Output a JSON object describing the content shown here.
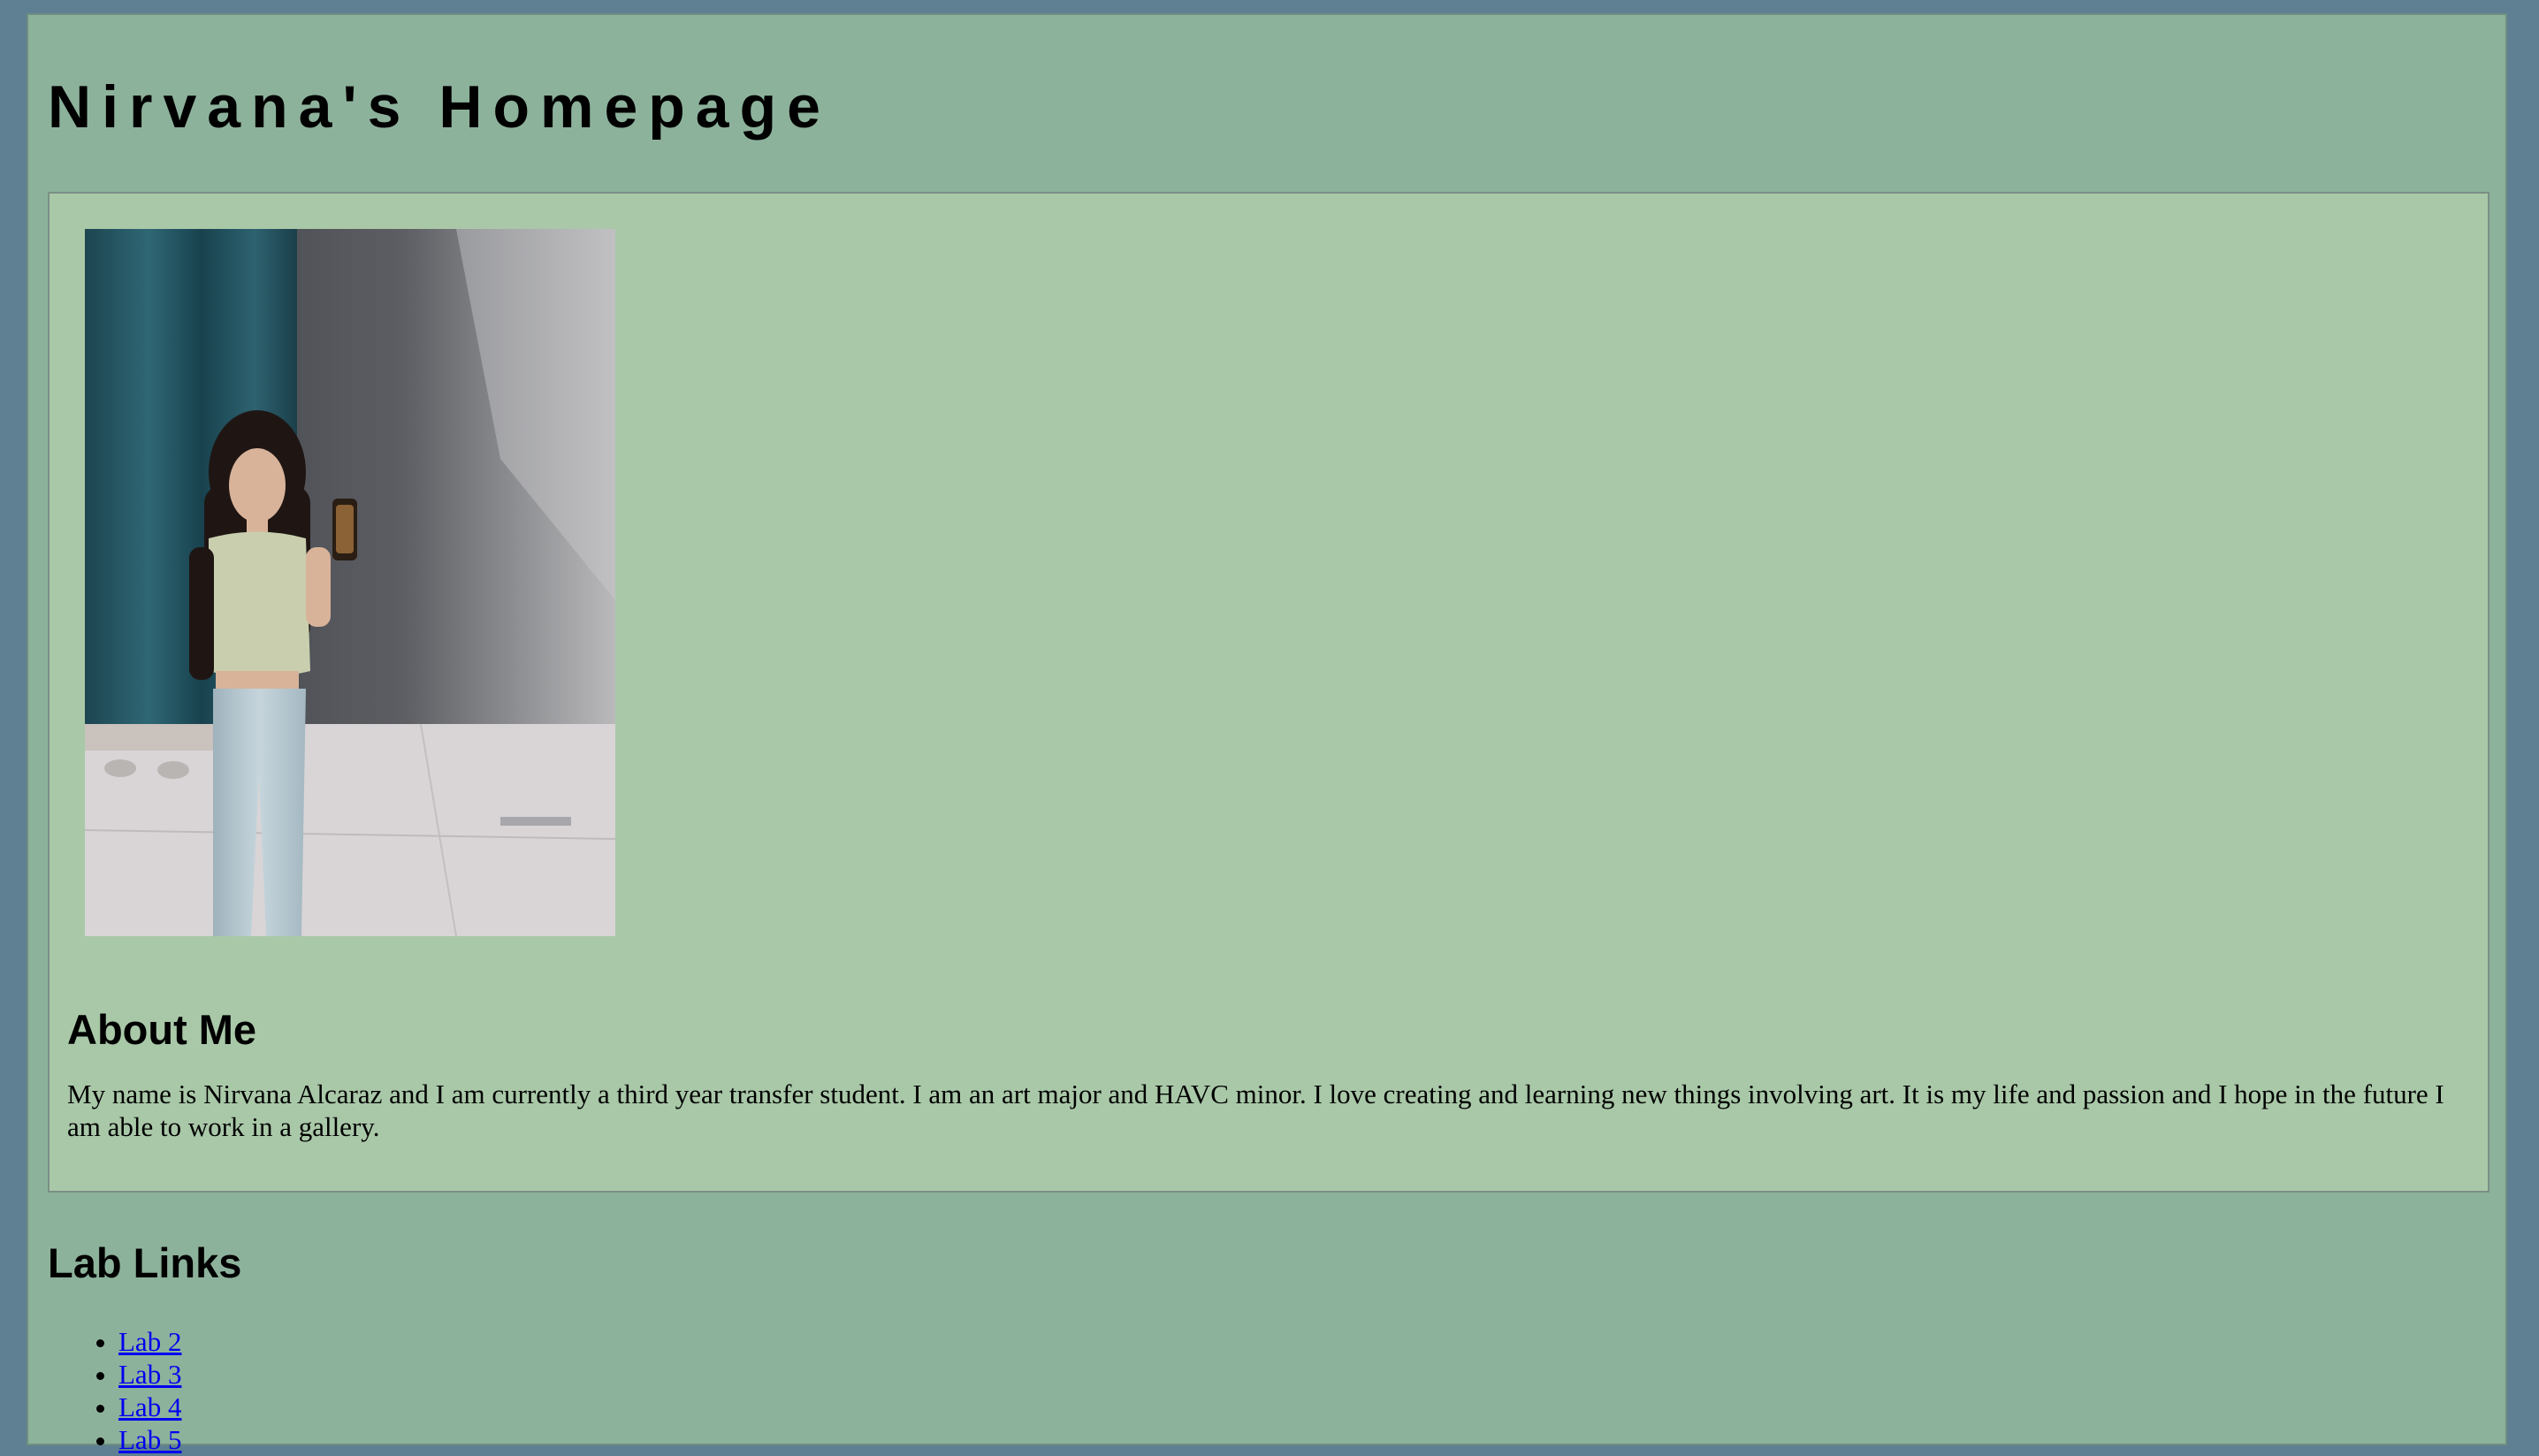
{
  "header": {
    "title": "Nirvana's Homepage"
  },
  "profile": {
    "photo_alt": "Mirror selfie of Nirvana in a fitting room"
  },
  "about": {
    "heading": "About Me",
    "text": "My name is Nirvana Alcaraz and I am currently a third year transfer student. I am an art major and HAVC minor. I love creating and learning new things involving art. It is my life and passion and I hope in the future I am able to work in a gallery."
  },
  "lab_links": {
    "heading": "Lab Links",
    "items": [
      {
        "label": "Lab 2"
      },
      {
        "label": "Lab 3"
      },
      {
        "label": "Lab 4"
      },
      {
        "label": "Lab 5"
      }
    ]
  },
  "colors": {
    "outer_background": "#5e8092",
    "page_background": "#8db29c",
    "card_background": "#a9c8a8",
    "link": "#0000ee"
  }
}
